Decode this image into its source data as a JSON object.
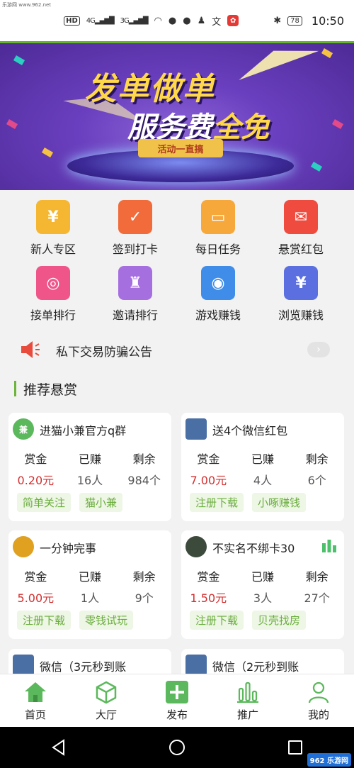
{
  "watermark_top": "乐游网 www.962.net",
  "watermark_bottom": "962 乐游网",
  "status": {
    "hd": "HD",
    "signal1": "4G",
    "signal2": "3G",
    "battery": "78",
    "time": "10:50"
  },
  "banner": {
    "title_line1": "发单做单",
    "title_line2_a": "服务费",
    "title_line2_b": "全免",
    "ribbon": "活动一直搞"
  },
  "grid": [
    {
      "label": "新人专区",
      "color": "#f5b731",
      "icon": "money-bag-icon",
      "glyph": "¥"
    },
    {
      "label": "签到打卡",
      "color": "#f26b3a",
      "icon": "calendar-check-icon",
      "glyph": "✓"
    },
    {
      "label": "每日任务",
      "color": "#f7a83a",
      "icon": "gift-box-icon",
      "glyph": "▭"
    },
    {
      "label": "悬赏红包",
      "color": "#ef4b3f",
      "icon": "red-envelope-icon",
      "glyph": "✉"
    },
    {
      "label": "接单排行",
      "color": "#f0558a",
      "icon": "award-medal-icon",
      "glyph": "◎"
    },
    {
      "label": "邀请排行",
      "color": "#a66fe0",
      "icon": "trophy-icon",
      "glyph": "♜"
    },
    {
      "label": "游戏赚钱",
      "color": "#3f8de8",
      "icon": "gamepad-icon",
      "glyph": "◉"
    },
    {
      "label": "浏览赚钱",
      "color": "#5b6fe0",
      "icon": "yen-coin-icon",
      "glyph": "¥"
    }
  ],
  "notice": {
    "text": "私下交易防骗公告",
    "arrow": "›"
  },
  "section_title": "推荐悬赏",
  "labels": {
    "reward": "赏金",
    "earned": "已赚",
    "remaining": "剩余"
  },
  "cards": [
    {
      "title": "进猫小兼官方q群",
      "avatar": "兼",
      "avatar_color": "#5cb85c",
      "reward": "0.20元",
      "earned": "16人",
      "remaining": "984个",
      "tags": [
        "简单关注",
        "猫小兼"
      ]
    },
    {
      "title": "送4个微信红包",
      "avatar": "",
      "avatar_color": "#4a6fa5",
      "reward": "7.00元",
      "earned": "4人",
      "remaining": "6个",
      "tags": [
        "注册下载",
        "小啄赚钱"
      ]
    },
    {
      "title": "一分钟完事",
      "avatar": "",
      "avatar_color": "#e0a020",
      "reward": "5.00元",
      "earned": "1人",
      "remaining": "9个",
      "tags": [
        "注册下载",
        "零钱试玩"
      ]
    },
    {
      "title": "不实名不绑卡30",
      "avatar": "",
      "avatar_color": "#3c4a3c",
      "reward": "1.50元",
      "earned": "3人",
      "remaining": "27个",
      "tags": [
        "注册下载",
        "贝壳找房"
      ]
    },
    {
      "title": "微信（3元秒到账",
      "avatar": "",
      "avatar_color": "#4a6fa5"
    },
    {
      "title": "微信（2元秒到账",
      "avatar": "",
      "avatar_color": "#4a6fa5"
    }
  ],
  "tabs": [
    {
      "label": "首页",
      "icon": "home-icon"
    },
    {
      "label": "大厅",
      "icon": "cube-icon"
    },
    {
      "label": "发布",
      "icon": "plus-icon"
    },
    {
      "label": "推广",
      "icon": "bar-chart-icon"
    },
    {
      "label": "我的",
      "icon": "user-icon"
    }
  ],
  "colors": {
    "brand_green": "#67b52f",
    "money_red": "#d32f2f",
    "tag_green": "#6aad3c"
  }
}
